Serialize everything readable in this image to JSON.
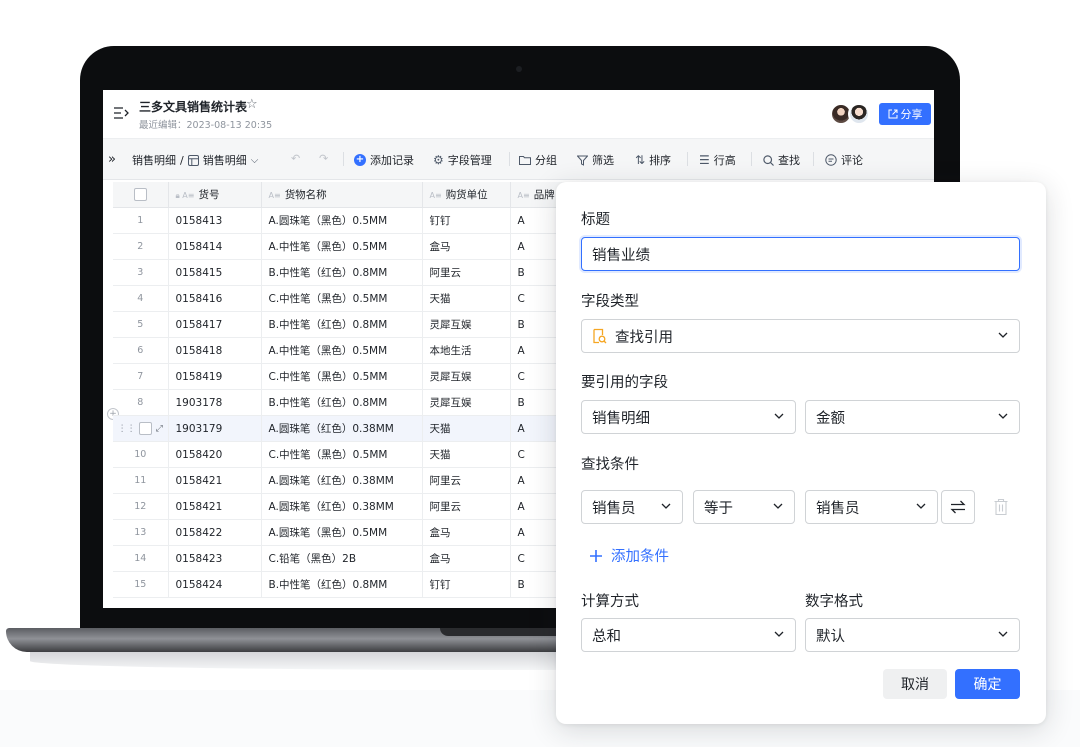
{
  "doc": {
    "title": "三多文具销售统计表",
    "meta": "最近编辑：2023-08-13 20:35",
    "share": "分享"
  },
  "toolbar": {
    "expand_glyph": "»",
    "table_name": "销售明细",
    "separator": "/",
    "view_name": "销售明细",
    "add_record": "添加记录",
    "field_manage": "字段管理",
    "group": "分组",
    "filter": "筛选",
    "sort": "排序",
    "row_height": "行高",
    "search": "查找",
    "comment": "评论"
  },
  "table": {
    "columns": [
      "货号",
      "货物名称",
      "购货单位",
      "品牌"
    ],
    "rows": [
      [
        "1",
        "0158413",
        "A.圆珠笔（黑色）0.5MM",
        "钉钉",
        "A"
      ],
      [
        "2",
        "0158414",
        "A.中性笔（黑色）0.5MM",
        "盒马",
        "A"
      ],
      [
        "3",
        "0158415",
        "B.中性笔（红色）0.8MM",
        "阿里云",
        "B"
      ],
      [
        "4",
        "0158416",
        "C.中性笔（黑色）0.5MM",
        "天猫",
        "C"
      ],
      [
        "5",
        "0158417",
        "B.中性笔（红色）0.8MM",
        "灵犀互娱",
        "B"
      ],
      [
        "6",
        "0158418",
        "A.中性笔（黑色）0.5MM",
        "本地生活",
        "A"
      ],
      [
        "7",
        "0158419",
        "C.中性笔（黑色）0.5MM",
        "灵犀互娱",
        "C"
      ],
      [
        "8",
        "1903178",
        "B.中性笔（红色）0.8MM",
        "灵犀互娱",
        "B"
      ],
      [
        "",
        "1903179",
        "A.圆珠笔（红色）0.38MM",
        "天猫",
        "A"
      ],
      [
        "10",
        "0158420",
        "C.中性笔（黑色）0.5MM",
        "天猫",
        "C"
      ],
      [
        "11",
        "0158421",
        "A.圆珠笔（红色）0.38MM",
        "阿里云",
        "A"
      ],
      [
        "12",
        "0158421",
        "A.圆珠笔（红色）0.38MM",
        "阿里云",
        "A"
      ],
      [
        "13",
        "0158422",
        "A.圆珠笔（黑色）0.5MM",
        "盒马",
        "A"
      ],
      [
        "14",
        "0158423",
        "C.铅笔（黑色）2B",
        "盒马",
        "C"
      ],
      [
        "15",
        "0158424",
        "B.中性笔（红色）0.8MM",
        "钉钉",
        "B"
      ]
    ]
  },
  "dialog": {
    "title_label": "标题",
    "title_value": "销售业绩",
    "type_label": "字段类型",
    "type_value": "查找引用",
    "ref_label": "要引用的字段",
    "ref_table": "销售明细",
    "ref_field": "金额",
    "cond_label": "查找条件",
    "cond_left": "销售员",
    "cond_op": "等于",
    "cond_right": "销售员",
    "add_condition": "添加条件",
    "calc_label": "计算方式",
    "calc_value": "总和",
    "format_label": "数字格式",
    "format_value": "默认",
    "cancel": "取消",
    "confirm": "确定"
  },
  "colors": {
    "accent": "#3370ff",
    "lookup_icon": "#f5a623"
  }
}
